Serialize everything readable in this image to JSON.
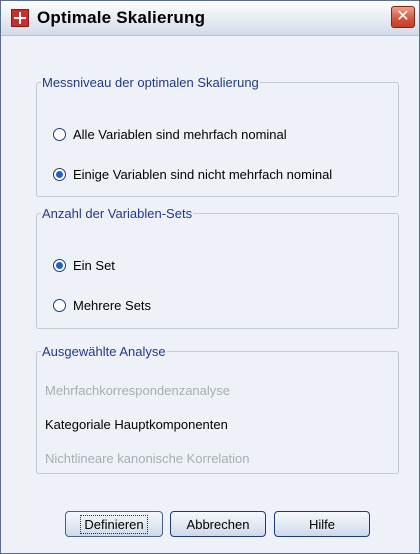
{
  "window": {
    "title": "Optimale Skalierung",
    "close_symbol": "✕"
  },
  "measurement_group": {
    "legend": "Messniveau der optimalen Skalierung",
    "options": [
      {
        "label": "Alle Variablen sind mehrfach nominal",
        "selected": false
      },
      {
        "label": "Einige Variablen sind nicht mehrfach nominal",
        "selected": true
      }
    ]
  },
  "sets_group": {
    "legend": "Anzahl der Variablen-Sets",
    "options": [
      {
        "label": "Ein Set",
        "selected": true
      },
      {
        "label": "Mehrere Sets",
        "selected": false
      }
    ]
  },
  "analysis_group": {
    "legend": "Ausgewählte Analyse",
    "items": [
      {
        "label": "Mehrfachkorrespondenzanalyse",
        "enabled": false
      },
      {
        "label": "Kategoriale Hauptkomponenten",
        "enabled": true
      },
      {
        "label": "Nichtlineare kanonische Korrelation",
        "enabled": false
      }
    ]
  },
  "buttons": {
    "define": "Definieren",
    "cancel": "Abbrechen",
    "help": "Hilfe"
  }
}
